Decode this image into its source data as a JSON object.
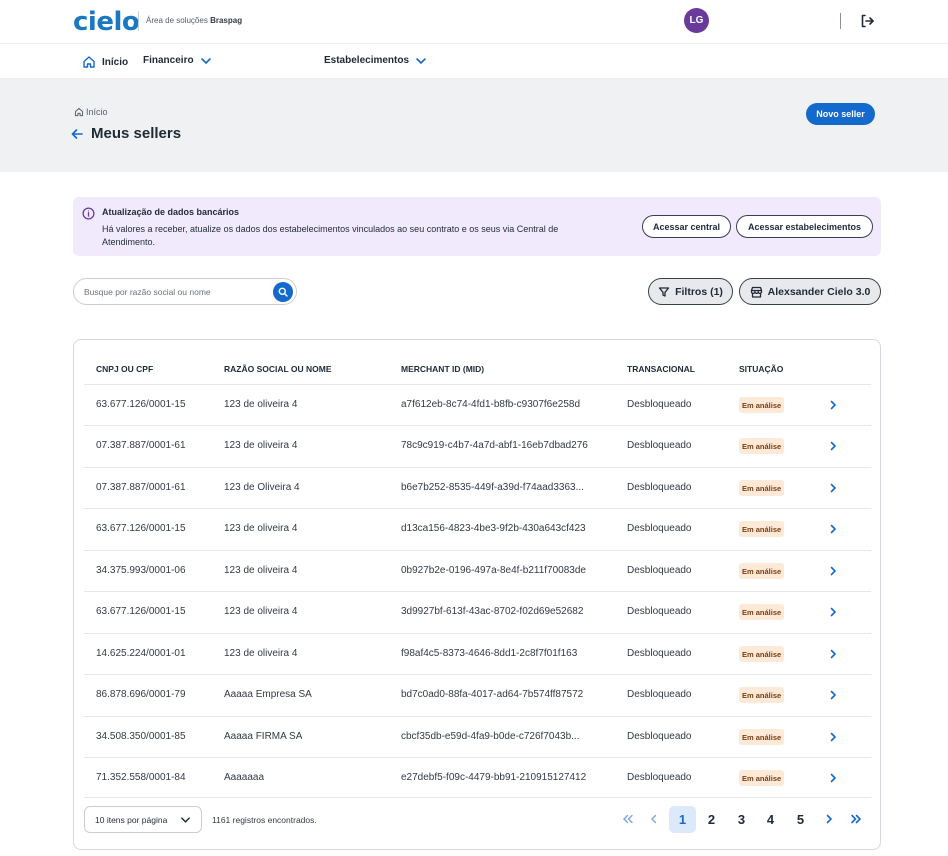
{
  "header": {
    "logo": "cielo",
    "subtitle_prefix": "Área de soluções",
    "subtitle_brand": "Braspag",
    "avatar_initials": "LG",
    "logout_icon": "logout-icon"
  },
  "nav": {
    "home": "Início",
    "financeiro": "Financeiro",
    "estabelecimentos": "Estabelecimentos"
  },
  "page": {
    "breadcrumb": "Início",
    "title": "Meus sellers",
    "new_seller_button": "Novo seller"
  },
  "alert": {
    "title": "Atualização de dados bancários",
    "text": "Há valores a receber, atualize os dados dos estabelecimentos vinculados ao seu contrato e os seus via Central de Atendimento.",
    "button_central": "Acessar central",
    "button_estabelecimentos": "Acessar estabelecimentos"
  },
  "toolbar": {
    "search_placeholder": "Busque por razão social ou nome",
    "filters_label": "Filtros (1)",
    "store_label": "Alexsander Cielo 3.0"
  },
  "table": {
    "columns": [
      "CNPJ OU CPF",
      "RAZÃO SOCIAL OU NOME",
      "MERCHANT ID (MID)",
      "TRANSACIONAL",
      "SITUAÇÃO"
    ],
    "rows": [
      {
        "doc": "63.677.126/0001-15",
        "name": "123 de oliveira 4",
        "mid": "a7f612eb-8c74-4fd1-b8fb-c9307f6e258d",
        "transacional": "Desbloqueado",
        "situacao": "Em análise"
      },
      {
        "doc": "07.387.887/0001-61",
        "name": "123 de oliveira 4",
        "mid": "78c9c919-c4b7-4a7d-abf1-16eb7dbad276",
        "transacional": "Desbloqueado",
        "situacao": "Em análise"
      },
      {
        "doc": "07.387.887/0001-61",
        "name": "123 de Oliveira 4",
        "mid": "b6e7b252-8535-449f-a39d-f74aad3363...",
        "transacional": "Desbloqueado",
        "situacao": "Em análise"
      },
      {
        "doc": "63.677.126/0001-15",
        "name": "123 de oliveira 4",
        "mid": "d13ca156-4823-4be3-9f2b-430a643cf423",
        "transacional": "Desbloqueado",
        "situacao": "Em análise"
      },
      {
        "doc": "34.375.993/0001-06",
        "name": "123 de oliveira 4",
        "mid": "0b927b2e-0196-497a-8e4f-b211f70083de",
        "transacional": "Desbloqueado",
        "situacao": "Em análise"
      },
      {
        "doc": "63.677.126/0001-15",
        "name": "123 de oliveira 4",
        "mid": "3d9927bf-613f-43ac-8702-f02d69e52682",
        "transacional": "Desbloqueado",
        "situacao": "Em análise"
      },
      {
        "doc": "14.625.224/0001-01",
        "name": "123 de oliveira 4",
        "mid": "f98af4c5-8373-4646-8dd1-2c8f7f01f163",
        "transacional": "Desbloqueado",
        "situacao": "Em análise"
      },
      {
        "doc": "86.878.696/0001-79",
        "name": "Aaaaa Empresa SA",
        "mid": "bd7c0ad0-88fa-4017-ad64-7b574ff87572",
        "transacional": "Desbloqueado",
        "situacao": "Em análise"
      },
      {
        "doc": "34.508.350/0001-85",
        "name": "Aaaaa FIRMA SA",
        "mid": "cbcf35db-e59d-4fa9-b0de-c726f7043b...",
        "transacional": "Desbloqueado",
        "situacao": "Em análise"
      },
      {
        "doc": "71.352.558/0001-84",
        "name": "Aaaaaaa",
        "mid": "e27debf5-f09c-4479-bb91-210915127412",
        "transacional": "Desbloqueado",
        "situacao": "Em análise"
      }
    ]
  },
  "footer": {
    "per_page": "10 itens por página",
    "records": "1161 registros encontrados.",
    "pages": [
      "1",
      "2",
      "3",
      "4",
      "5"
    ],
    "current_page": "1"
  },
  "colors": {
    "brand_blue": "#1469cc",
    "avatar_purple": "#6a3a9b",
    "alert_bg": "#f1eafc",
    "badge_bg": "#fde9d7"
  }
}
